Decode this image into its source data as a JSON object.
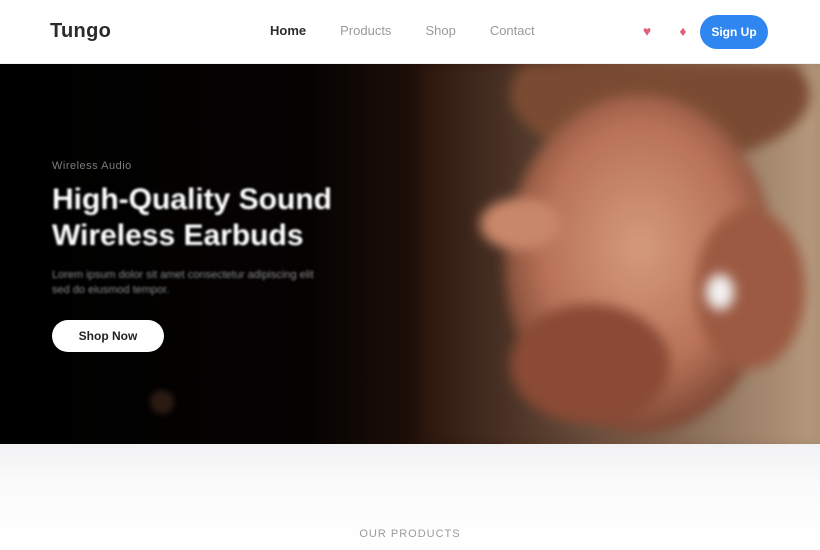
{
  "header": {
    "logo": "Tungo",
    "nav": [
      "Home",
      "Products",
      "Shop",
      "Contact"
    ],
    "icons": [
      "heart-icon",
      "cart-icon"
    ],
    "cta_label": "Sign Up"
  },
  "hero": {
    "eyebrow": "Wireless Audio",
    "title_line1": "High-Quality Sound",
    "title_line2": "Wireless Earbuds",
    "description": "Lorem ipsum dolor sit amet consectetur adipiscing elit sed do eiusmod tempor.",
    "button_label": "Shop Now"
  },
  "section": {
    "label": "OUR PRODUCTS"
  },
  "colors": {
    "accent": "#2f86f0",
    "hero_dark": "#000000",
    "icon_pink": "#e0607a"
  }
}
